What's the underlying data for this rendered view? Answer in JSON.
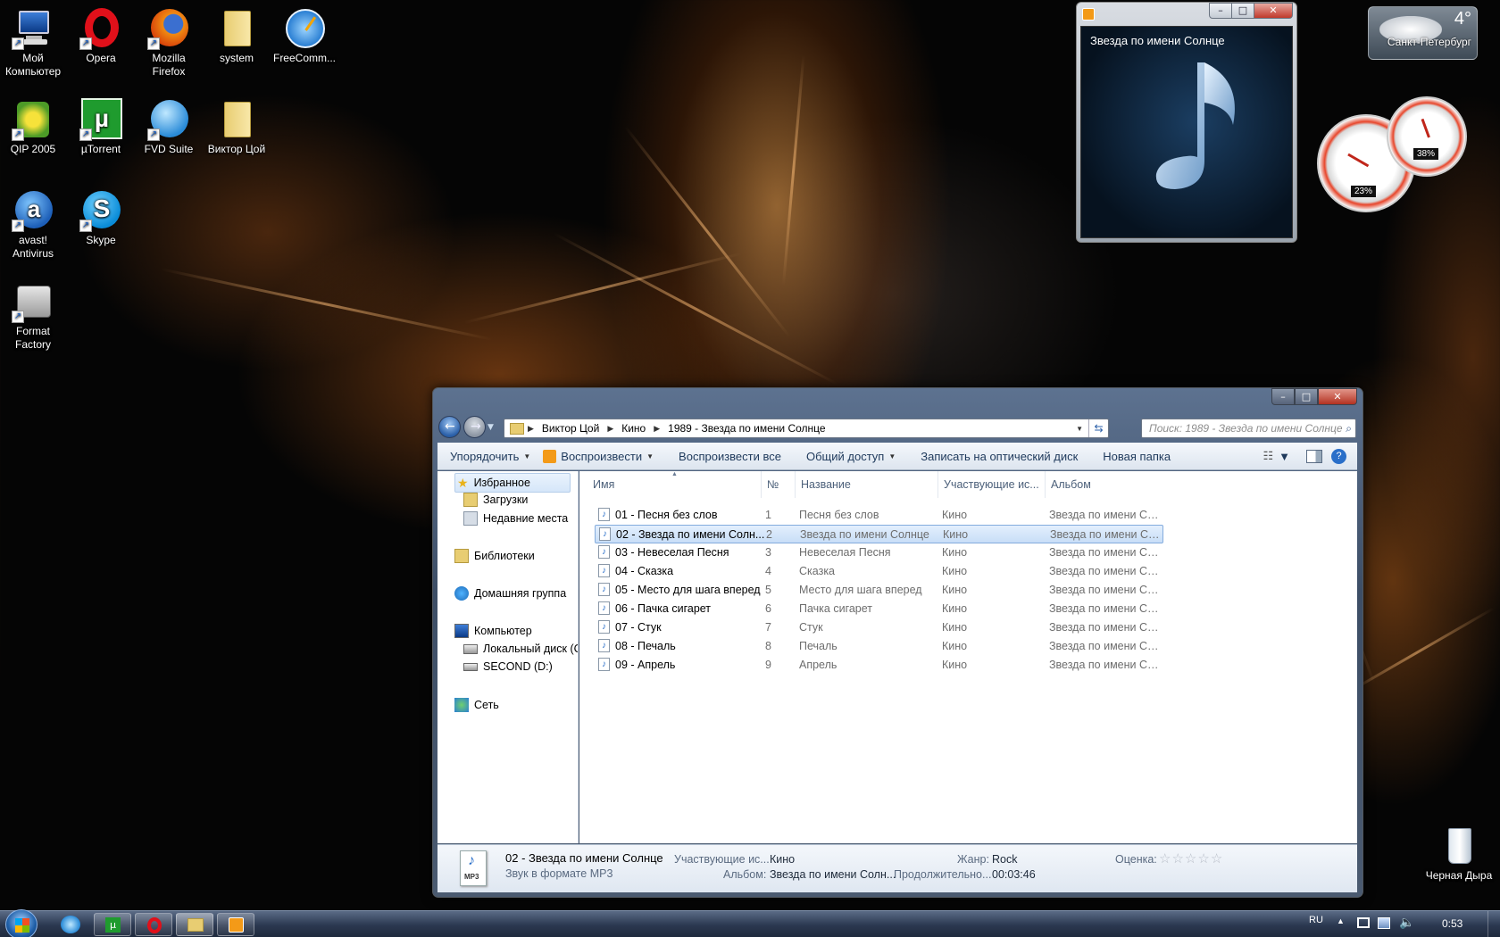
{
  "desktop": {
    "icons": [
      {
        "label": "Мой Компьютер",
        "icon": "computer-icon"
      },
      {
        "label": "Opera",
        "icon": "opera-icon"
      },
      {
        "label": "Mozilla Firefox",
        "icon": "firefox-icon"
      },
      {
        "label": "system",
        "icon": "folder-icon"
      },
      {
        "label": "FreeComm...",
        "icon": "freecommander-icon"
      },
      {
        "label": "QIP 2005",
        "icon": "qip-icon"
      },
      {
        "label": "µTorrent",
        "icon": "utorrent-icon"
      },
      {
        "label": "FVD Suite",
        "icon": "fvd-suite-icon"
      },
      {
        "label": "Виктор Цой",
        "icon": "folder-icon"
      },
      {
        "label": "avast! Antivirus",
        "icon": "avast-icon"
      },
      {
        "label": "Skype",
        "icon": "skype-icon"
      },
      {
        "label": "Format Factory",
        "icon": "format-factory-icon"
      }
    ],
    "recycle_bin": "Черная Дыра"
  },
  "media_player": {
    "song_title": "Звезда по имени Солнце",
    "buttons": {
      "minimize": "–",
      "maximize": "□",
      "close": "✕"
    }
  },
  "weather": {
    "temperature": "4°",
    "city": "Санкт-Петербург"
  },
  "gauges": {
    "cpu_percent": "23%",
    "memory_percent": "38%"
  },
  "explorer": {
    "window_buttons": {
      "minimize": "–",
      "maximize": "□",
      "close": "✕"
    },
    "breadcrumb": [
      "Виктор Цой",
      "Кино",
      "1989 - Звезда по имени Солнце"
    ],
    "search_placeholder": "Поиск: 1989 - Звезда по имени Солнце",
    "toolbar": {
      "organize": "Упорядочить",
      "play": "Воспроизвести",
      "play_all": "Воспроизвести все",
      "share": "Общий доступ",
      "burn": "Записать на оптический диск",
      "new_folder": "Новая папка"
    },
    "nav": {
      "favorites": "Избранное",
      "downloads": "Загрузки",
      "recent": "Недавние места",
      "libraries": "Библиотеки",
      "homegroup": "Домашняя группа",
      "computer": "Компьютер",
      "local_disk": "Локальный диск (C",
      "second_disk": "SECOND (D:)",
      "network": "Сеть"
    },
    "columns": {
      "name": "Имя",
      "number": "№",
      "title": "Название",
      "artists": "Участвующие ис...",
      "album": "Альбом"
    },
    "files": [
      {
        "name": "01 - Песня без слов",
        "number": "1",
        "title": "Песня без слов",
        "artist": "Кино",
        "album": "Звезда по имени Со..."
      },
      {
        "name": "02 - Звезда по имени Солн...",
        "number": "2",
        "title": "Звезда по имени Солнце",
        "artist": "Кино",
        "album": "Звезда по имени Со..."
      },
      {
        "name": "03 - Невеселая Песня",
        "number": "3",
        "title": "Невеселая Песня",
        "artist": "Кино",
        "album": "Звезда по имени Со..."
      },
      {
        "name": "04 - Сказка",
        "number": "4",
        "title": "Сказка",
        "artist": "Кино",
        "album": "Звезда по имени Со..."
      },
      {
        "name": "05 - Место для шага вперед",
        "number": "5",
        "title": "Место для шага вперед",
        "artist": "Кино",
        "album": "Звезда по имени Со..."
      },
      {
        "name": "06 - Пачка сигарет",
        "number": "6",
        "title": "Пачка сигарет",
        "artist": "Кино",
        "album": "Звезда по имени Со..."
      },
      {
        "name": "07 - Стук",
        "number": "7",
        "title": "Стук",
        "artist": "Кино",
        "album": "Звезда по имени Со..."
      },
      {
        "name": "08 - Печаль",
        "number": "8",
        "title": "Печаль",
        "artist": "Кино",
        "album": "Звезда по имени Со..."
      },
      {
        "name": "09 - Апрель",
        "number": "9",
        "title": "Апрель",
        "artist": "Кино",
        "album": "Звезда по имени Со..."
      }
    ],
    "selected_index": 1,
    "details": {
      "file_name": "02 - Звезда по имени Солнце",
      "file_type": "Звук в формате MP3",
      "thumb_label": "MP3",
      "artists_label": "Участвующие ис...",
      "artists_value": "Кино",
      "album_label": "Альбом:",
      "album_value": "Звезда по имени Солн...",
      "genre_label": "Жанр:",
      "genre_value": "Rock",
      "duration_label": "Продолжительно...",
      "duration_value": "00:03:46",
      "rating_label": "Оценка:",
      "rating_value": 0,
      "rating_max": 5
    }
  },
  "taskbar": {
    "language": "RU",
    "clock": "0:53",
    "items": [
      "ie-icon",
      "utorrent-icon",
      "opera-icon",
      "explorer-icon",
      "media-player-icon"
    ]
  }
}
